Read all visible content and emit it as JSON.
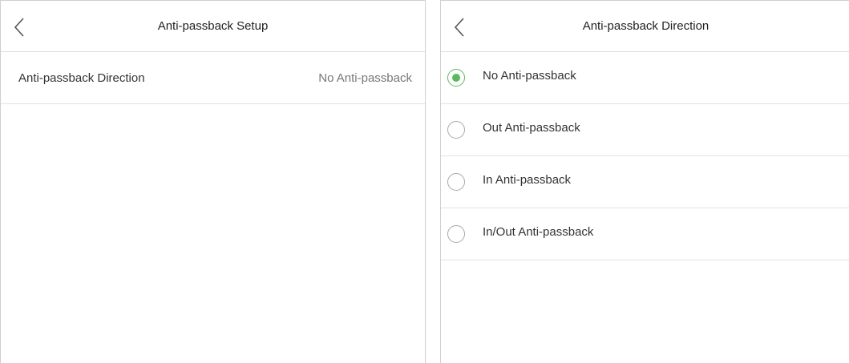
{
  "setup_screen": {
    "title": "Anti-passback Setup",
    "rows": [
      {
        "label": "Anti-passback Direction",
        "value": "No Anti-passback"
      }
    ]
  },
  "direction_screen": {
    "title": "Anti-passback Direction",
    "selected_index": 0,
    "options": [
      {
        "label": "No Anti-passback",
        "selected": true
      },
      {
        "label": "Out Anti-passback",
        "selected": false
      },
      {
        "label": "In Anti-passback",
        "selected": false
      },
      {
        "label": "In/Out Anti-passback",
        "selected": false
      }
    ]
  },
  "colors": {
    "accent": "#5cb85c",
    "border": "#cfcfcf",
    "text": "#333333",
    "muted_text": "#777777"
  },
  "icons": {
    "back": "chevron-left-icon",
    "radio": "radio-button-icon"
  }
}
